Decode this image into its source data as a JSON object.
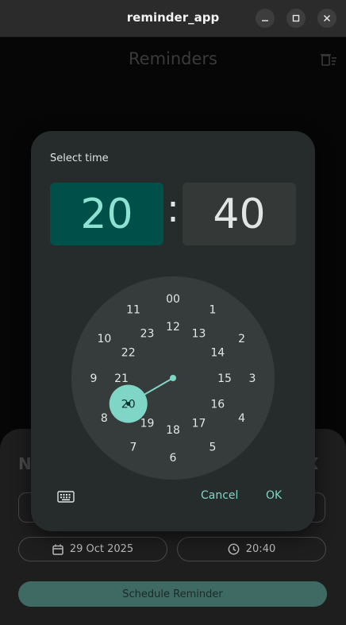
{
  "window": {
    "title": "reminder_app"
  },
  "appbar": {
    "title": "Reminders"
  },
  "sheet": {
    "title_start": "N",
    "title_end": "X",
    "date": "29 Oct 2025",
    "time": "20:40",
    "schedule_label": "Schedule Reminder"
  },
  "time_picker": {
    "header": "Select time",
    "hour": "20",
    "separator": ":",
    "minute": "40",
    "selected_hour": "20",
    "outer_hours": [
      "00",
      "1",
      "2",
      "3",
      "4",
      "5",
      "6",
      "7",
      "8",
      "9",
      "10",
      "11"
    ],
    "inner_hours": [
      "12",
      "13",
      "14",
      "15",
      "16",
      "17",
      "18",
      "19",
      "20",
      "21",
      "22",
      "23"
    ],
    "cancel_label": "Cancel",
    "ok_label": "OK"
  },
  "colors": {
    "accent": "#7fd6c6",
    "hour_box_bg": "#00504a",
    "dialog_bg": "#262b2b"
  }
}
